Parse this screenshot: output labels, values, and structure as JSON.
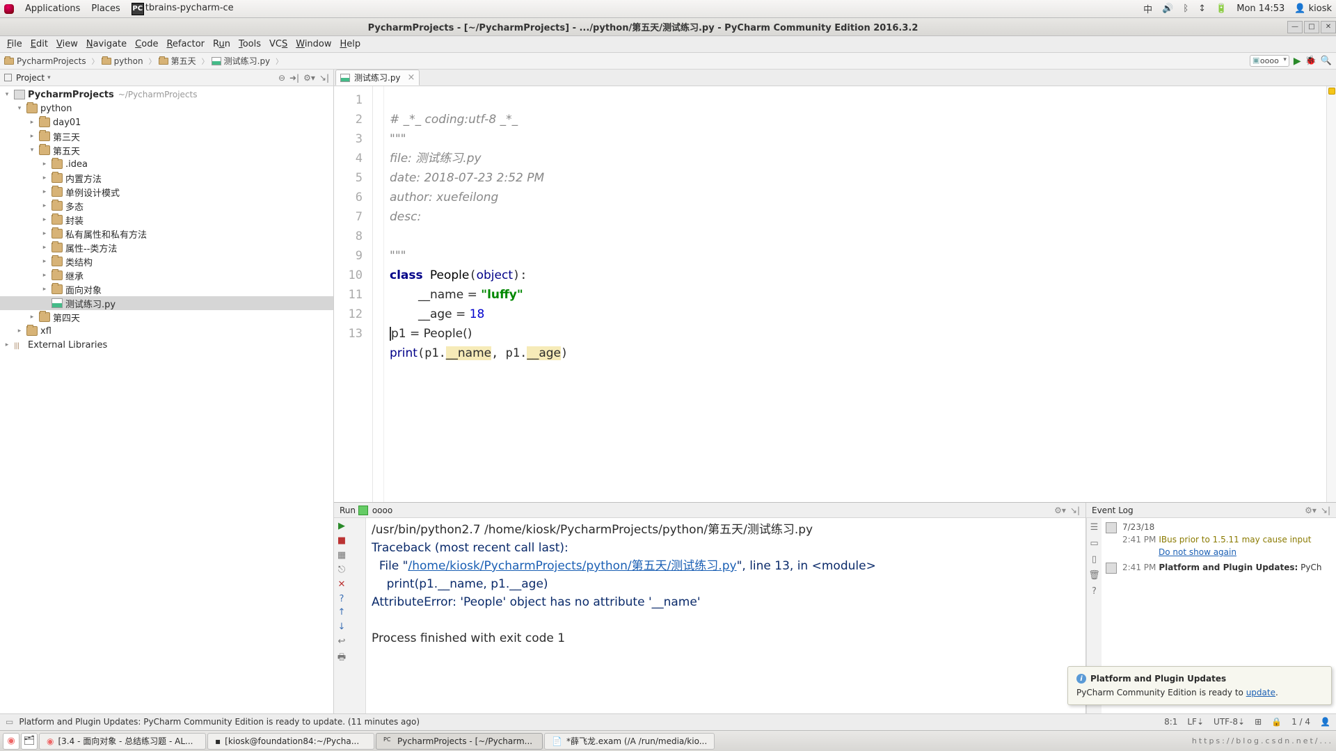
{
  "gnome": {
    "apps": "Applications",
    "places": "Places",
    "appIndicator": "tbrains-pycharm-ce",
    "clock": "Mon 14:53",
    "user": "kiosk"
  },
  "window": {
    "title": "PycharmProjects - [~/PycharmProjects] - .../python/第五天/测试练习.py - PyCharm Community Edition 2016.3.2"
  },
  "menu": {
    "file": "File",
    "edit": "Edit",
    "view": "View",
    "navigate": "Navigate",
    "code": "Code",
    "refactor": "Refactor",
    "run": "Run",
    "tools": "Tools",
    "vcs": "VCS",
    "window": "Window",
    "help": "Help"
  },
  "breadcrumbs": {
    "root": "PycharmProjects",
    "b1": "python",
    "b2": "第五天",
    "b3": "测试练习.py",
    "config": "ᴏᴏᴏᴏ"
  },
  "project": {
    "header": "Project",
    "root": "PycharmProjects",
    "rootPath": "~/PycharmProjects",
    "python": "python",
    "day01": "day01",
    "d3": "第三天",
    "d5": "第五天",
    "idea": ".idea",
    "nzff": "内置方法",
    "dlsj": "单例设计模式",
    "dt": "多态",
    "fz": "封装",
    "syff": "私有属性和私有方法",
    "sxff": "属性--类方法",
    "ljg": "类结构",
    "jc": "继承",
    "mxdx": "面向对象",
    "file": "测试练习.py",
    "d4": "第四天",
    "xfl": "xfl",
    "extlib": "External Libraries"
  },
  "tab": {
    "name": "测试练习.py"
  },
  "code": {
    "l1": "# _*_ coding:utf-8 _*_",
    "l2": "\"\"\"",
    "l3": "file: 测试练习.py",
    "l4": "date: 2018-07-23 2:52 PM",
    "l5": "author: xuefeilong",
    "l6": "desc:",
    "l7": "",
    "l8": "\"\"\"",
    "l10_name": "__name = ",
    "l10_str": "\"luffy\"",
    "l11_age": "__age = ",
    "l11_num": "18",
    "l12": "p1 = People()",
    "l13_name": "__name",
    "l13_age": "__age"
  },
  "run": {
    "header": "Run",
    "config": "ᴏᴏᴏᴏ",
    "cmd": "/usr/bin/python2.7 /home/kiosk/PycharmProjects/python/第五天/测试练习.py",
    "tb": "Traceback (most recent call last):",
    "filePre": "  File \"",
    "fileLink": "/home/kiosk/PycharmProjects/python/第五天/测试练习.py",
    "filePost": "\", line 13, in <module>",
    "errline": "    print(p1.__name, p1.__age)",
    "attrerr": "AttributeError: 'People' object has no attribute '__name'",
    "exit": "Process finished with exit code 1"
  },
  "eventlog": {
    "header": "Event Log",
    "date": "7/23/18",
    "t1time": "2:41 PM",
    "t1msg": "IBus prior to 1.5.11 may cause input",
    "t1link": "Do not show again",
    "t2time": "2:41 PM",
    "t2bold": "Platform and Plugin Updates:",
    "t2msg": " PyCh"
  },
  "popup": {
    "title": "Platform and Plugin Updates",
    "body": "PyCharm Community Edition is ready to ",
    "link": "update"
  },
  "status": {
    "msg": "Platform and Plugin Updates: PyCharm Community Edition is ready to update. (11 minutes ago)",
    "pos": "8:1",
    "lf": "LF⇣",
    "enc": "UTF-8⇣",
    "ctx": "⊞",
    "prog": "1 / 4"
  },
  "taskbar": {
    "t1": "[3.4 - 面向对象 - 总结练习题 - AL...",
    "t2": "[kiosk@foundation84:~/Pycha...",
    "t3": "PycharmProjects - [~/Pycharm...",
    "t4": "*薛飞龙.exam (/A /run/media/kio..."
  }
}
